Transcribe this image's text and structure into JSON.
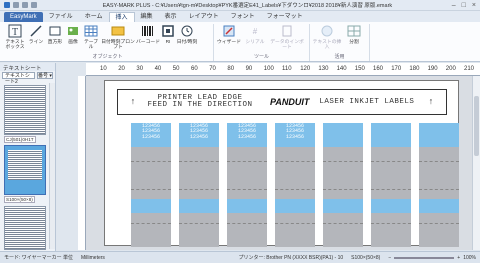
{
  "titlebar": {
    "title": "EASY-MARK PLUS - C:¥Users¥tgn-m¥Desktop¥PYK番選定E41_Labels¥下ダウンロ¥2018 2018¥新人演習 原版.emark"
  },
  "menu": {
    "app": "EasyMark",
    "tabs": [
      "ファイル",
      "ホーム",
      "挿入",
      "編集",
      "表示",
      "レイアウト",
      "フォント",
      "フォーマット"
    ],
    "active": "挿入"
  },
  "ribbon": {
    "groups": [
      {
        "label": "オブジェクト",
        "items": [
          "テキストボックス",
          "ライン",
          "直方形",
          "画像",
          "テーブル",
          "日付時刻プロンプト",
          "バーコード",
          "RI",
          "日付/時刻"
        ]
      },
      {
        "label": "ツール",
        "items": [
          "ウィザード",
          "シリアル",
          "データのインポート"
        ]
      },
      {
        "label": "活用",
        "items": [
          "テキストの挿入",
          "分割"
        ]
      }
    ]
  },
  "leftpanel": {
    "header": "テキストシート",
    "selector": "テキストシート2",
    "button": "番号 ▾",
    "thumb_labels": [
      "CJ(501)0H1T",
      "S100×(50×8)"
    ]
  },
  "ruler": {
    "ticks": [
      "10",
      "20",
      "30",
      "40",
      "50",
      "60",
      "70",
      "80",
      "90",
      "100",
      "110",
      "120",
      "130",
      "140",
      "150",
      "160",
      "170",
      "180",
      "190",
      "200",
      "210"
    ]
  },
  "banner": {
    "arrow": "↑",
    "lead_line1": "PRINTER LEAD EDGE",
    "lead_line2": "FEED IN THE DIRECTION",
    "brand": "PANDUIT",
    "text": "LASER INKJET LABELS"
  },
  "labels": {
    "sample": "123456",
    "rows": 3,
    "count": 7,
    "filled": 4
  },
  "statusbar": {
    "left": "モード: ワイヤーマーカー 単位",
    "unit": "Millimeters",
    "printer": "プリンター: Brother PN (XXXX BSR)(PA1) - 10",
    "item": "S100×(50×8)",
    "zoom": "100%"
  },
  "colors": {
    "accent": "#3f6fb5",
    "label_blue": "#7fc0ea",
    "label_gray": "#b4b6bb"
  }
}
